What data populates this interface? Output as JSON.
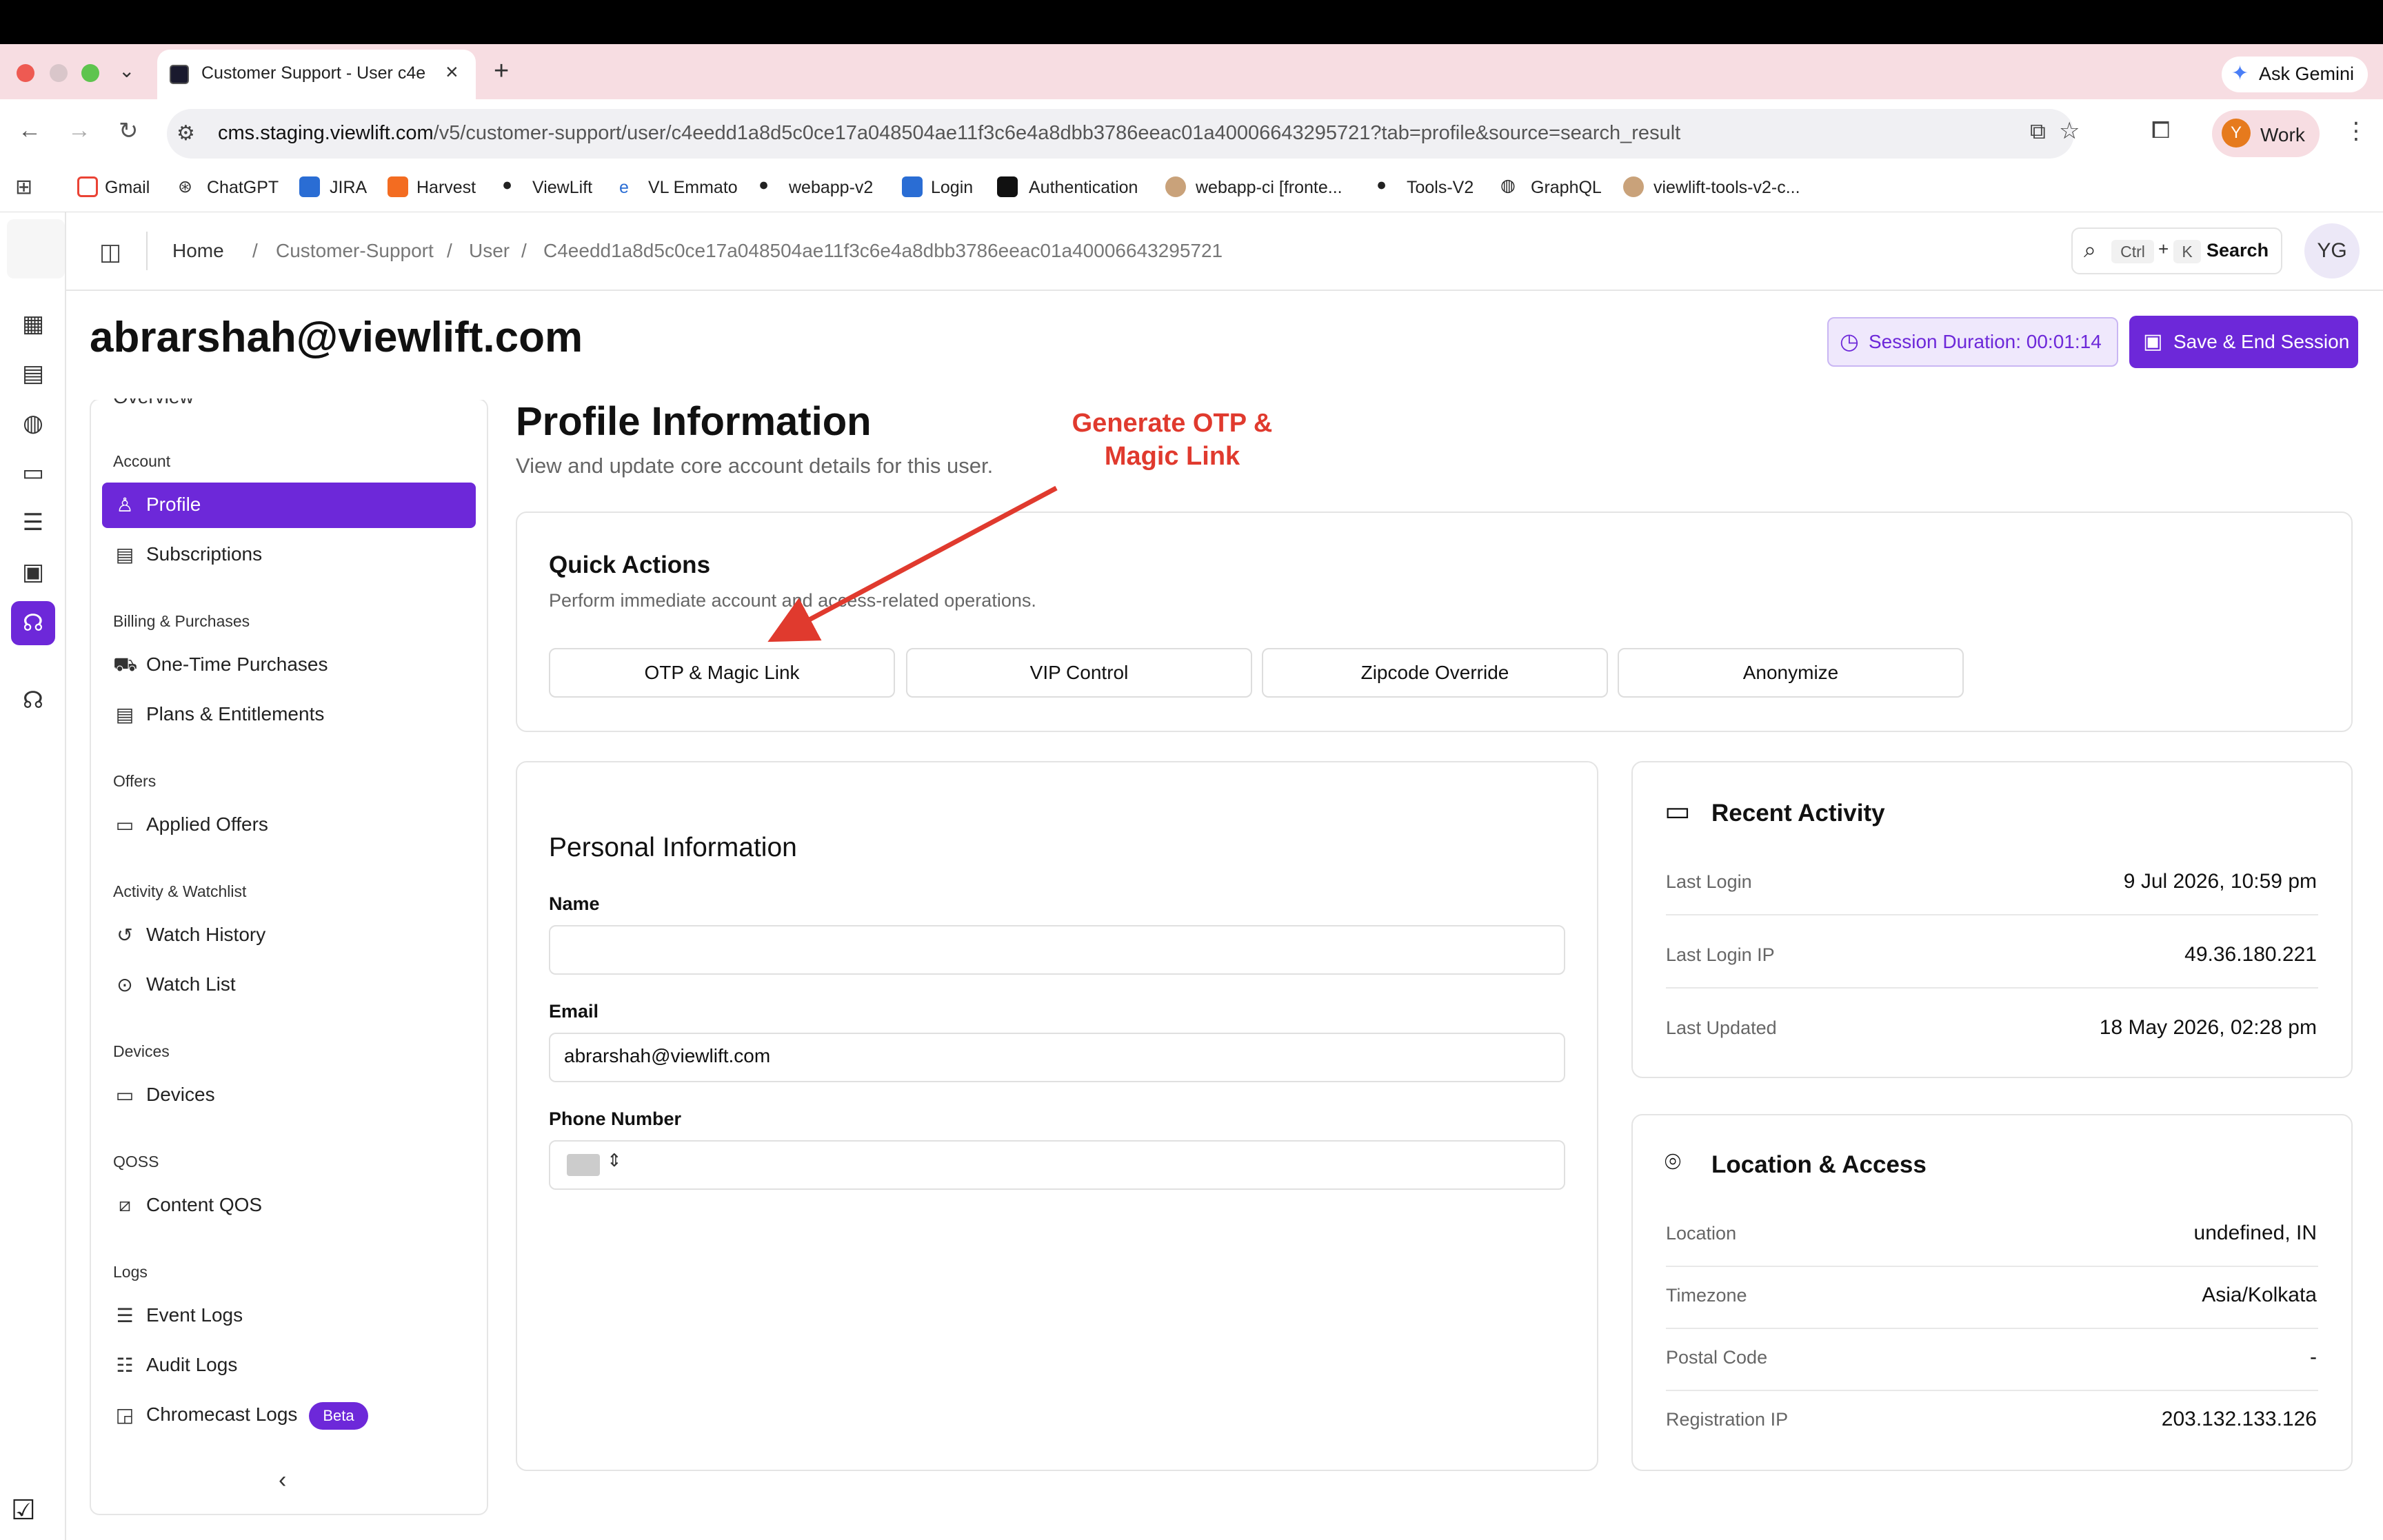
{
  "browser": {
    "tab_title": "Customer Support - User c4e",
    "gemini_label": "Ask Gemini",
    "url_domain": "cms.staging.viewlift.com",
    "url_path": "/v5/customer-support/user/c4eedd1a8d5c0ce17a048504ae11f3c6e4a8dbb3786eeac01a40006643295721?tab=profile&source=search_result",
    "profile_initial": "Y",
    "profile_label": "Work",
    "bookmarks": [
      "Gmail",
      "ChatGPT",
      "JIRA",
      "Harvest",
      "ViewLift",
      "VL Emmato",
      "webapp-v2",
      "Login",
      "Authentication",
      "webapp-ci [fronte...",
      "Tools-V2",
      "GraphQL",
      "viewlift-tools-v2-c..."
    ]
  },
  "header": {
    "breadcrumbs": [
      "Home",
      "Customer-Support",
      "User",
      "C4eedd1a8d5c0ce17a048504ae11f3c6e4a8dbb3786eeac01a40006643295721"
    ],
    "search_ctrl": "Ctrl",
    "search_plus": "+",
    "search_k": "K",
    "search_label": "Search",
    "avatar": "YG"
  },
  "page": {
    "title": "abrarshah@viewlift.com",
    "session_label": "Session Duration:  00:01:14",
    "save_end_label": "Save & End Session"
  },
  "nav": {
    "overview_partial": "Overview",
    "groups": {
      "account": "Account",
      "billing": "Billing & Purchases",
      "offers": "Offers",
      "activity": "Activity & Watchlist",
      "devices": "Devices",
      "qoss": "QOSS",
      "logs": "Logs"
    },
    "items": {
      "profile": "Profile",
      "subscriptions": "Subscriptions",
      "one_time": "One-Time Purchases",
      "plans": "Plans & Entitlements",
      "applied_offers": "Applied Offers",
      "watch_history": "Watch History",
      "watch_list": "Watch List",
      "devices": "Devices",
      "content_qos": "Content QOS",
      "event_logs": "Event Logs",
      "audit_logs": "Audit Logs",
      "chromecast_logs": "Chromecast Logs"
    },
    "beta_badge": "Beta"
  },
  "profile": {
    "title": "Profile Information",
    "subtitle": "View and update core account details for this user.",
    "annotation": "Generate OTP & Magic Link"
  },
  "quick_actions": {
    "title": "Quick Actions",
    "subtitle": "Perform immediate account and access-related operations.",
    "buttons": [
      "OTP & Magic Link",
      "VIP Control",
      "Zipcode Override",
      "Anonymize"
    ]
  },
  "personal_info": {
    "title": "Personal Information",
    "name_label": "Name",
    "name_value": "",
    "email_label": "Email",
    "email_value": "abrarshah@viewlift.com",
    "phone_label": "Phone Number",
    "phone_value": ""
  },
  "recent_activity": {
    "title": "Recent Activity",
    "rows": [
      {
        "key": "Last Login",
        "value": "9 Jul 2026, 10:59 pm"
      },
      {
        "key": "Last Login IP",
        "value": "49.36.180.221"
      },
      {
        "key": "Last Updated",
        "value": "18 May 2026, 02:28 pm"
      }
    ]
  },
  "location_access": {
    "title": "Location & Access",
    "rows": [
      {
        "key": "Location",
        "value": "undefined, IN"
      },
      {
        "key": "Timezone",
        "value": "Asia/Kolkata"
      },
      {
        "key": "Postal Code",
        "value": "-"
      },
      {
        "key": "Registration IP",
        "value": "203.132.133.126"
      }
    ]
  },
  "colors": {
    "accent": "#6d28d9",
    "annotation": "#e03a2e",
    "tab_strip": "#f7dde2"
  }
}
